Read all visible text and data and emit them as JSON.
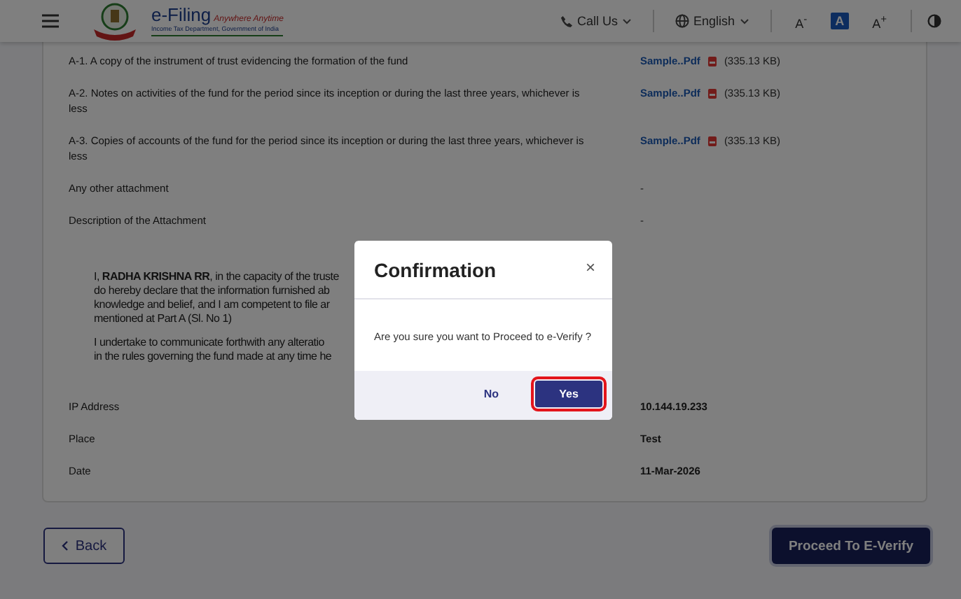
{
  "header": {
    "logo": {
      "title": "e-Filing",
      "tagline": "Anywhere Anytime",
      "subtitle": "Income Tax Department, Government of India"
    },
    "call_us": "Call Us",
    "language": "English",
    "font_controls": [
      {
        "label": "A$^{-}$",
        "selected": false
      },
      {
        "label": "A",
        "selected": true
      },
      {
        "label": "A$^{+}$",
        "selected": false
      }
    ]
  },
  "attachments": [
    {
      "label": "A-1. A copy of the instrument of trust evidencing the formation of the fund",
      "file": "Sample..Pdf",
      "size": "(335.13 KB)"
    },
    {
      "label": "A-2. Notes on activities of the fund for the period since its inception or during the last three years, whichever is less",
      "file": "Sample..Pdf",
      "size": "(335.13 KB)"
    },
    {
      "label": "A-3. Copies of accounts of the fund for the period since its inception or during the last three years, whichever is less",
      "file": "Sample..Pdf",
      "size": "(335.13 KB)"
    }
  ],
  "other_fields": [
    {
      "label": "Any other attachment",
      "value": "-"
    },
    {
      "label": "Description of the Attachment",
      "value": "-"
    }
  ],
  "declaration": [
    [
      "I, **RADHA KRISHNA RR**, in the capacity of the truste",
      "do hereby declare that the information furnished ab",
      "knowledge and belief, and I am competent to file ar",
      "mentioned at Part A (Sl. No 1)"
    ],
    [
      "I undertake to communicate forthwith any alteratio",
      "in the rules governing the fund made at any time he"
    ]
  ],
  "details": [
    {
      "label": "IP Address",
      "value": "10.144.19.233"
    },
    {
      "label": "Place",
      "value": "Test"
    },
    {
      "label": "Date",
      "value": "11-Mar-2026"
    }
  ],
  "back_button": "Back",
  "proceed_button": "Proceed To E-Verify",
  "modal": {
    "title": "Confirmation",
    "close": "×",
    "message": "Are you sure you want to Proceed to e-Verify ?",
    "buttons": [
      {
        "label": "No",
        "kind": "secondary",
        "highlighted": false
      },
      {
        "label": "Yes",
        "kind": "primary",
        "highlighted": true
      }
    ]
  }
}
